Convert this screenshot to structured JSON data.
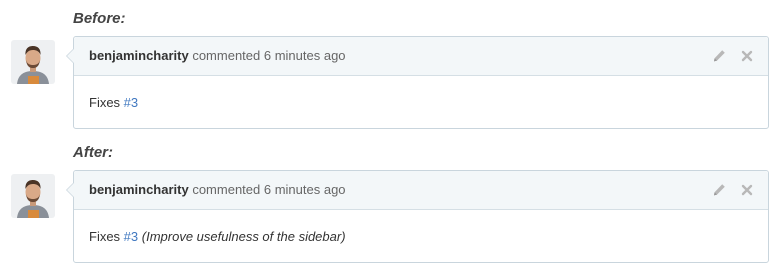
{
  "before": {
    "label": "Before:",
    "comment": {
      "author": "benjamincharity",
      "action": "commented 6 minutes ago",
      "body_text": "Fixes ",
      "issue_ref": "#3",
      "issue_title": ""
    }
  },
  "after": {
    "label": "After:",
    "comment": {
      "author": "benjamincharity",
      "action": "commented 6 minutes ago",
      "body_text": "Fixes ",
      "issue_ref": "#3",
      "issue_title": "(Improve usefulness of the sidebar)"
    }
  },
  "icons": {
    "edit": "pencil-icon",
    "delete": "close-icon"
  },
  "colors": {
    "link": "#4078c0",
    "header_bg": "#f3f7f9",
    "border": "#c9d5dd"
  }
}
